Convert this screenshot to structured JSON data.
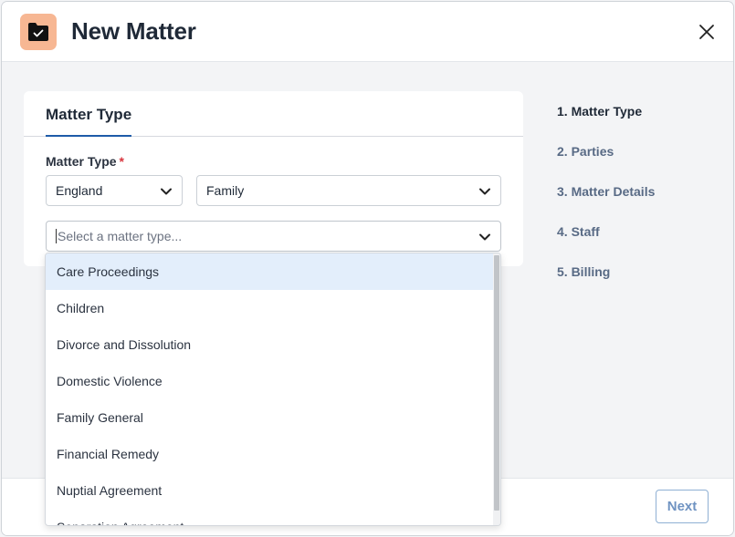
{
  "modal": {
    "title": "New Matter"
  },
  "card": {
    "tab_label": "Matter Type",
    "field_label": "Matter Type",
    "required_mark": "*",
    "country_value": "England",
    "area_value": "Family",
    "type_placeholder": "Select a matter type..."
  },
  "dropdown": {
    "options": [
      "Care Proceedings",
      "Children",
      "Divorce and Dissolution",
      "Domestic Violence",
      "Family General",
      "Financial Remedy",
      "Nuptial Agreement",
      "Separation Agreement"
    ],
    "highlighted_index": 0
  },
  "steps": [
    "1. Matter Type",
    "2. Parties",
    "3. Matter Details",
    "4. Staff",
    "5. Billing"
  ],
  "footer": {
    "next_label": "Next"
  },
  "colors": {
    "accent": "#1e5ba8",
    "icon_bg": "#f7b793",
    "required": "#d9363e",
    "highlight": "#e3eefb"
  },
  "icons": {
    "app": "folder-check-icon",
    "close": "close-icon",
    "chevron": "chevron-down-icon"
  }
}
